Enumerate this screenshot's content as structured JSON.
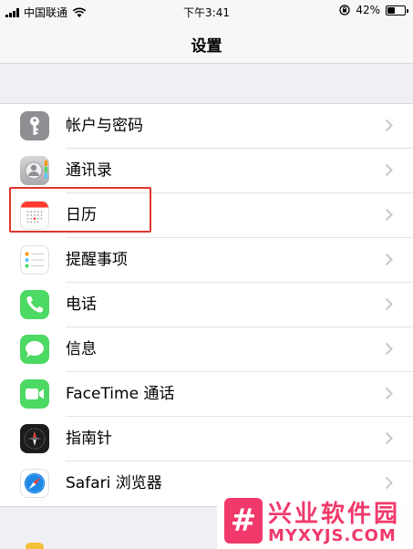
{
  "status_bar": {
    "carrier": "中国联通",
    "time": "下午3:41",
    "battery_text": "42%",
    "battery_level": 0.42
  },
  "nav": {
    "title": "设置"
  },
  "settings_items": [
    {
      "label": "帐户与密码",
      "icon": "key-icon",
      "color": "#8e8e93"
    },
    {
      "label": "通讯录",
      "icon": "contacts-icon",
      "color": "#b9b9bd"
    },
    {
      "label": "日历",
      "icon": "calendar-icon",
      "color": "#ffffff"
    },
    {
      "label": "提醒事项",
      "icon": "reminders-icon",
      "color": "#ffffff"
    },
    {
      "label": "电话",
      "icon": "phone-icon",
      "color": "#4cd964"
    },
    {
      "label": "信息",
      "icon": "messages-icon",
      "color": "#4cd964"
    },
    {
      "label": "FaceTime 通话",
      "icon": "facetime-icon",
      "color": "#4cd964"
    },
    {
      "label": "指南针",
      "icon": "compass-icon",
      "color": "#1c1c1e"
    },
    {
      "label": "Safari 浏览器",
      "icon": "safari-icon",
      "color": "#ffffff"
    }
  ],
  "watermark": {
    "title": "兴业软件园",
    "url": "MYXYJS.COM",
    "color": "#f0396a"
  }
}
